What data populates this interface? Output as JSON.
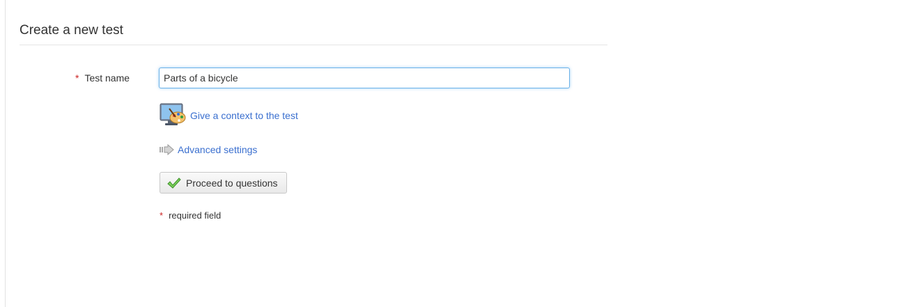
{
  "form": {
    "title": "Create a new test",
    "required_marker": "*",
    "test_name_label": "Test name",
    "test_name_value": "Parts of a bicycle",
    "context_link": "Give a context to the test",
    "context_icon": "palette-monitor-icon",
    "advanced_link": "Advanced settings",
    "advanced_icon": "arrow-right-icon",
    "proceed_button": "Proceed to questions",
    "proceed_icon": "checkmark-icon",
    "required_note": "required field"
  },
  "colors": {
    "link": "#3a6fcf",
    "required": "#cc2222",
    "input_focus_border": "#6cb2e8",
    "check_green": "#5cb83a"
  }
}
